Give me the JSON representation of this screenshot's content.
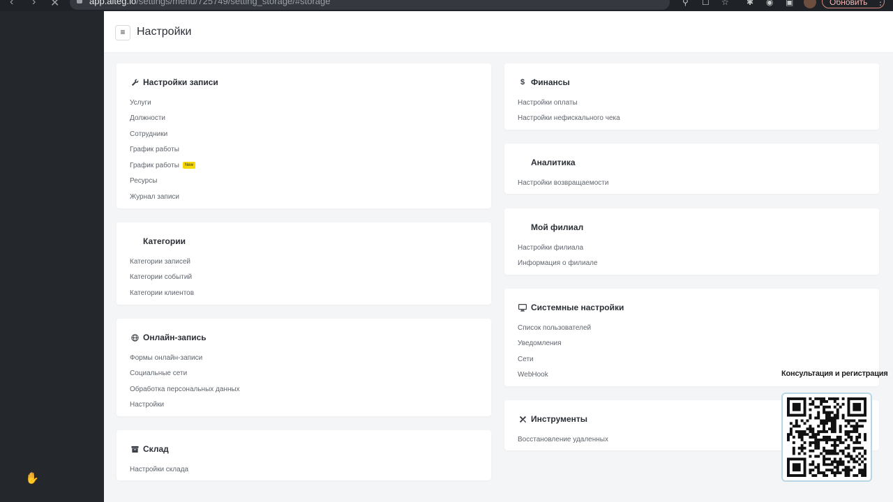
{
  "browser": {
    "url_host": "app.alteg.io",
    "url_path": "/settings/menu/725749/setting_storage/#storage",
    "update_label": "Обновить"
  },
  "page": {
    "title": "Настройки"
  },
  "cards": {
    "booking": {
      "title": "Настройки записи",
      "icon": "wrench-icon",
      "items": [
        "Услуги",
        "Должности",
        "Сотрудники",
        "График работы",
        "График работы",
        "Ресурсы",
        "Журнал записи"
      ],
      "badge": "New"
    },
    "categories": {
      "title": "Категории",
      "items": [
        "Категории записей",
        "Категории событий",
        "Категории клиентов"
      ]
    },
    "online": {
      "title": "Онлайн-запись",
      "icon": "globe-icon",
      "items": [
        "Формы онлайн-записи",
        "Социальные сети",
        "Обработка персональных данных",
        "Настройки"
      ]
    },
    "storage": {
      "title": "Склад",
      "icon": "archive-icon",
      "items": [
        "Настройки склада"
      ]
    },
    "finance": {
      "title": "Финансы",
      "icon": "dollar-icon",
      "items": [
        "Настройки оплаты",
        "Настройки нефискального чека"
      ]
    },
    "analytics": {
      "title": "Аналитика",
      "items": [
        "Настройки возвращаемости"
      ]
    },
    "branch": {
      "title": "Мой филиал",
      "items": [
        "Настройки филиала",
        "Информация о филиале"
      ]
    },
    "system": {
      "title": "Системные настройки",
      "icon": "monitor-icon",
      "items": [
        "Список пользователей",
        "Уведомления",
        "Сети",
        "WebHook"
      ]
    },
    "tools": {
      "title": "Инструменты",
      "icon": "tools-icon",
      "items": [
        "Восстановление удаленных"
      ]
    }
  },
  "overlay": {
    "qr_caption": "Консультация и регистрация"
  }
}
